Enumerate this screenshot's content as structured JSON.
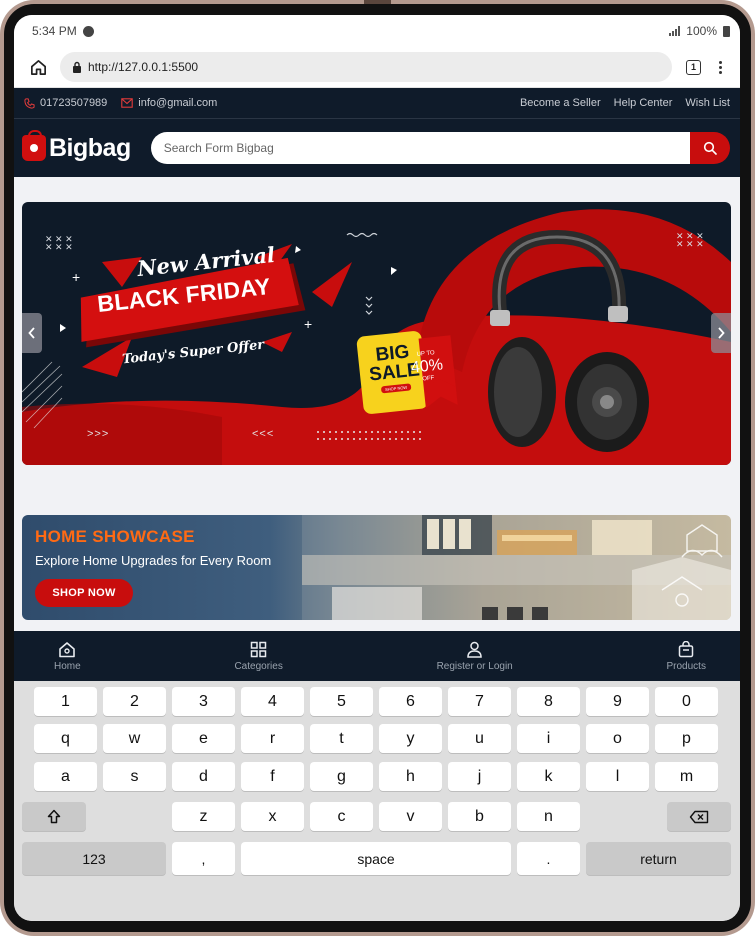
{
  "status_bar": {
    "time": "5:34 PM",
    "battery": "100%"
  },
  "browser": {
    "url": "http://127.0.0.1:5500",
    "tab_count": "1"
  },
  "top_info": {
    "phone": "01723507989",
    "email": "info@gmail.com",
    "links": [
      "Become a Seller",
      "Help Center",
      "Wish List"
    ]
  },
  "header": {
    "logo": "Bigbag",
    "search_placeholder": "Search Form Bigbag"
  },
  "hero": {
    "new_arrival": "New Arrival",
    "headline": "BLACK FRIDAY",
    "tagline": "Today's Super Offer",
    "big": "BIG",
    "sale": "SALE",
    "up_to": "UP TO",
    "percent": "40%",
    "off": "OFF",
    "shop_now_small": "SHOP NOW",
    "left_chevrons": ">>>",
    "right_chevrons": "<<<",
    "colors": {
      "red": "#c80d0d",
      "navy": "#0e1a28",
      "yellow": "#f7d21d"
    }
  },
  "showcase": {
    "title": "HOME SHOWCASE",
    "subtitle": "Explore Home Upgrades for Every Room",
    "button": "SHOP NOW"
  },
  "bottom_nav": [
    {
      "label": "Home",
      "icon": "home-icon"
    },
    {
      "label": "Categories",
      "icon": "grid-icon"
    },
    {
      "label": "Register or Login",
      "icon": "user-icon"
    },
    {
      "label": "Products",
      "icon": "bag-icon"
    }
  ],
  "keyboard": {
    "row1": [
      "1",
      "2",
      "3",
      "4",
      "5",
      "6",
      "7",
      "8",
      "9",
      "0"
    ],
    "row2": [
      "q",
      "w",
      "e",
      "r",
      "t",
      "y",
      "u",
      "i",
      "o",
      "p"
    ],
    "row3": [
      "a",
      "s",
      "d",
      "f",
      "g",
      "h",
      "j",
      "k",
      "l",
      "m"
    ],
    "row4": [
      "z",
      "x",
      "c",
      "v",
      "b",
      "n"
    ],
    "num_key": "123",
    "comma": ",",
    "space": "space",
    "period": ".",
    "return": "return"
  }
}
